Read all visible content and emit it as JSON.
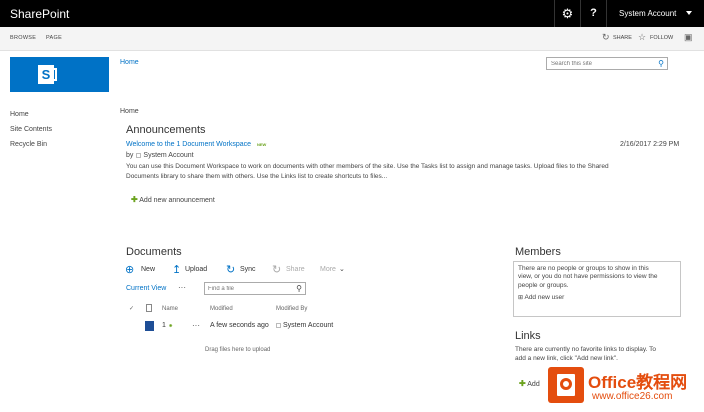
{
  "suite_bar": {
    "brand": "SharePoint",
    "settings_icon": "gear-icon",
    "help_label": "?",
    "account": "System Account"
  },
  "ribbon": {
    "tabs": [
      "BROWSE",
      "PAGE"
    ],
    "share": "SHARE",
    "follow": "FOLLOW"
  },
  "logo_letter": "S",
  "top_nav": {
    "home": "Home"
  },
  "search": {
    "placeholder": "Search this site"
  },
  "quick_launch": [
    "Home",
    "Site Contents",
    "Recycle Bin"
  ],
  "breadcrumb": "Home",
  "announcements": {
    "heading": "Announcements",
    "item": {
      "title": "Welcome to the 1 Document Workspace",
      "new_badge": "NEW",
      "date": "2/16/2017 2:29 PM",
      "by_label": "by",
      "author": "System Account",
      "body_line1": "You can use this Document Workspace to work on documents with other members of the site. Use the Tasks list to assign and manage tasks. Upload files to the Shared",
      "body_line2": "Documents library to share them with others. Use the Links list to create shortcuts to files..."
    },
    "add_new": "Add new announcement"
  },
  "documents": {
    "heading": "Documents",
    "commands": {
      "new": "New",
      "upload": "Upload",
      "sync": "Sync",
      "share": "Share",
      "more": "More"
    },
    "view": "Current View",
    "ellipsis": "···",
    "find_placeholder": "Find a file",
    "columns": {
      "name": "Name",
      "modified": "Modified",
      "modified_by": "Modified By"
    },
    "rows": [
      {
        "name": "1",
        "modified": "A few seconds ago",
        "modified_by": "System Account",
        "dots": "···"
      }
    ],
    "drag_hint": "Drag files here to upload"
  },
  "members": {
    "heading": "Members",
    "line1": "There are no people or groups to show in this",
    "line2": "view, or you do not have permissions to view the",
    "line3": "people or groups.",
    "add_new": "Add new user"
  },
  "links": {
    "heading": "Links",
    "line1": "There are currently no favorite links to display. To",
    "line2": "add a new link, click \"Add new link\".",
    "add_new": "Add"
  },
  "watermark": {
    "text1": "Office教程网",
    "text2": "www.office26.com"
  },
  "colors": {
    "suite_bg": "#000000",
    "accent": "#0072c6",
    "green": "#6ca31f",
    "watermark_orange": "#e44d0e"
  }
}
